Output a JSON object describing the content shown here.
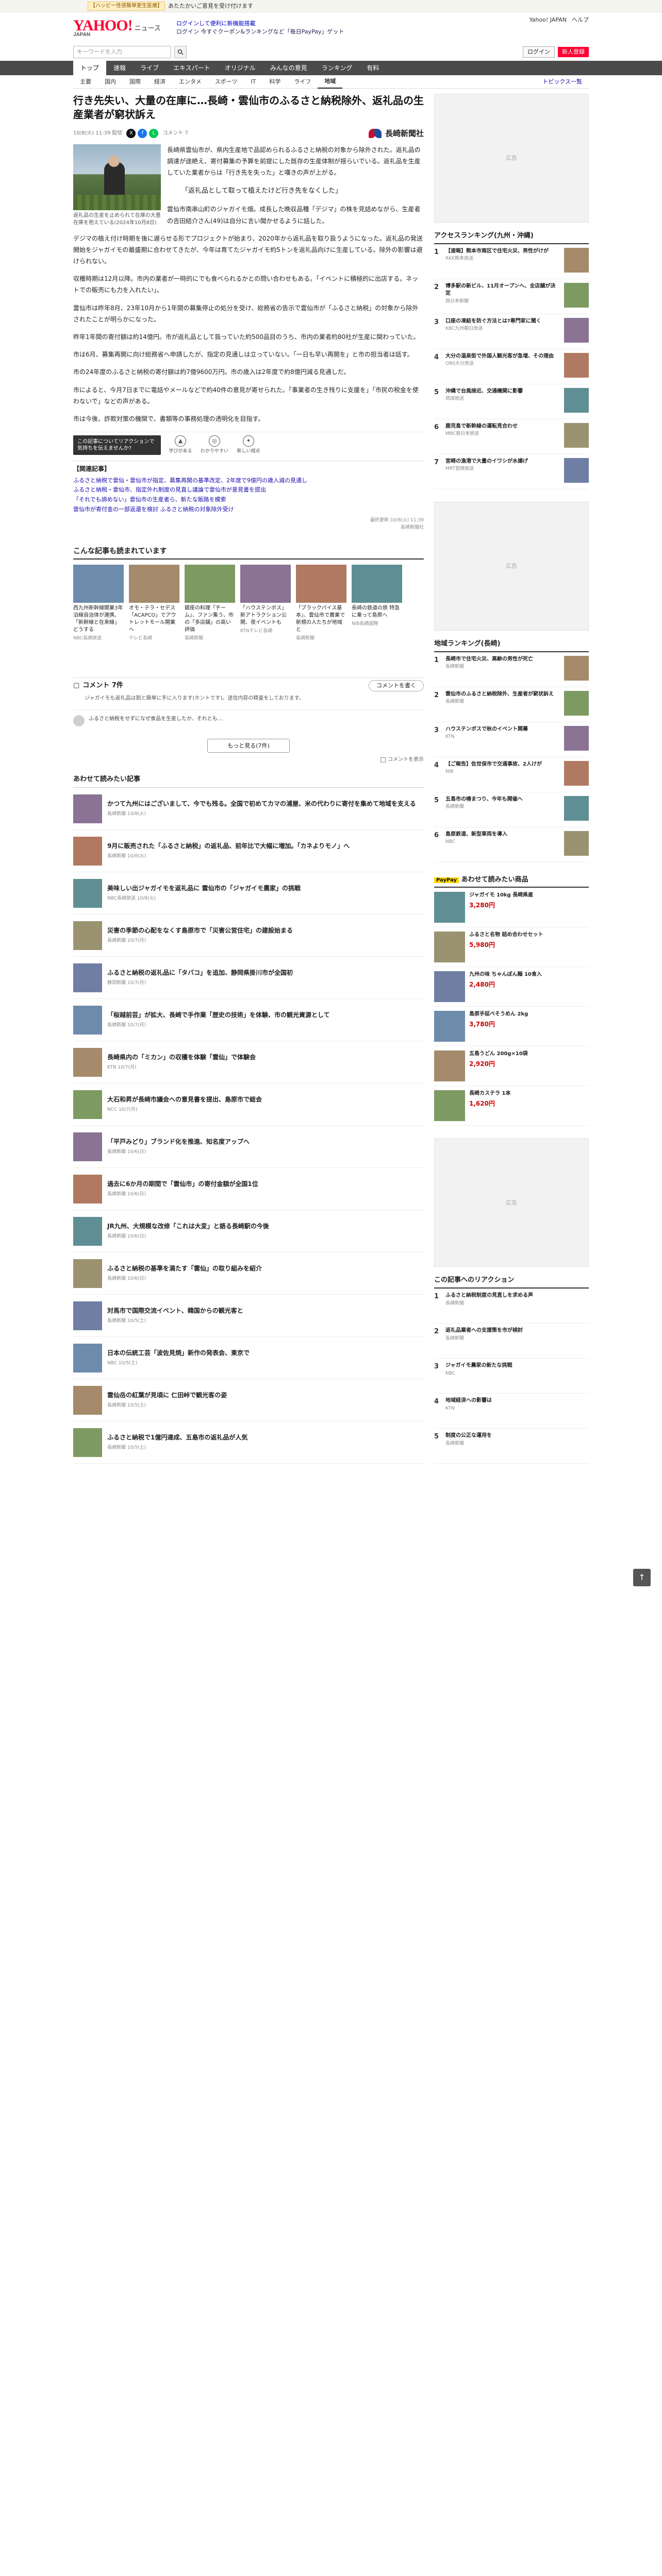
{
  "topbar": {
    "tag": "【ハッピー性感簡単更生医療】",
    "text": "あたたかいご意見を受け付けます"
  },
  "header": {
    "logo": "YAHOO!",
    "logo_sub": "JAPAN",
    "section": "ニュース",
    "link1": "ログインして便利に新機能搭載",
    "link2": "ログイン 今すぐクーポン&ランキングなど「毎日PayPay」ゲット",
    "right": [
      "Yahoo! JAPAN",
      "ヘルプ"
    ]
  },
  "search": {
    "placeholder": "キーワードを入力",
    "login": "ログイン",
    "register": "新人登録"
  },
  "nav": [
    "トップ",
    "速報",
    "ライブ",
    "エキスパート",
    "オリジナル",
    "みんなの意見",
    "ランキング",
    "有料"
  ],
  "subnav": [
    "主要",
    "国内",
    "国際",
    "経済",
    "エンタメ",
    "スポーツ",
    "IT",
    "科学",
    "ライフ",
    "地域"
  ],
  "subnav_active": "地域",
  "topics_link": "トピックス一覧",
  "article": {
    "title": "行き先失い、大量の在庫に…長崎・雲仙市のふるさと納税除外、返礼品の生産業者が窮状訴え",
    "date": "10/8(火) 11:39 配信",
    "comment_count": "コメント 7",
    "publisher": "長崎新聞社",
    "photo_caption": "返礼品の生産を止められて在庫の大量在庫を抱えている(2024年10月8日)",
    "paragraphs": [
      "長崎県雲仙市が、県内生産地で品認められるふるさと納税の対象から除外された。返礼品の調達が途絶え、寄付募集の予算を前提にした既存の生産体制が揺らいでいる。返礼品を生産していた業者からは「行き先を失った」と嘆きの声が上がる。",
      "雲仙市南串山町のジャガイモ畑。成長した晩収品種「デジマ」の株を見詰めながら、生産者の吉田結介さん(49)は自分に言い聞かせるように話した。",
      "デジマの植え付け時期を後に遅らせる形でプロジェクトが始まり、2020年から返礼品を取り扱うようになった。返礼品の発送開始をジャガイモの最盛期に合わせてきたが、今年は育てたジャガイモ約5トンを返礼品向けに生産している。除外の影響は避けられない。",
      "収穫時期は12月以降。市内の業者が一時的にでも食べられるかとの問い合わせもある。「イベントに積極的に出店する。ネットでの販売にも力を入れたい」。",
      "雲仙市は昨年8月、23年10月から1年間の募集停止の処分を受け、総務省の告示で雲仙市が「ふるさと納税」の対象から除外されたことが明らかになった。",
      "昨年1年間の寄付額は約14億円。市が返礼品として扱っていた約500品目のうち、市内の業者約80社が生産に関わっていた。",
      "市は6月、募集再開に向け総務省へ申請したが、指定の見通しは立っていない。「一日も早い再開を」と市の担当者は話す。",
      "市の24年度のふるさと納税の寄付額は約7億9600万円。市の歳入は2年度で約8億円減る見通しだ。",
      "市によると、今月7日までに電話やメールなどで約40件の意見が寄せられた。「事業者の生き残りに支援を」「市民の税金を使わないで」などの声がある。",
      "市は今後、詐欺対策の機関で、書類等の事務処理の透明化を目指す。"
    ],
    "quote": "「返礼品として取って植えたけど行き先をなくした」",
    "tip": "この記事についてリアクションで気持ちを伝えませんか?",
    "reactions": [
      "学びがある",
      "わかりやすい",
      "新しい視点"
    ],
    "related_title": "【関連記事】",
    "related": [
      "ふるさと納税で雲仙・雲仙市が指定、募集再開の基準改定、2年度で9億円の歳入減の見通し",
      "ふるさと納税・雲仙市、指定外れ制度の見直し議論で雲仙市が意見書を提出",
      "「それでも諦めない」雲仙市の生産者ら、新たな販路を模索",
      "雲仙市が寄付金の一部返還を検討 ふるさと納税の対象除外受け"
    ],
    "copyright": "最終更新:10/8(火) 11:39",
    "copyright2": "長崎新聞社"
  },
  "cards": {
    "title": "こんな記事も読まれています",
    "items": [
      {
        "t": "西九州新幹線開業3年 沿線自治体が連携、「新幹線と在来線」どうする",
        "src": "NBC長崎放送"
      },
      {
        "t": "オモ・テラ・セデス「ACAPCO」でアウトレットモール開業へ",
        "src": "テレビ長崎"
      },
      {
        "t": "銀座の料理「チーム」、ファン集う、市の「多店舗」の高い評価",
        "src": "長崎新聞"
      },
      {
        "t": "「ハウステンボス」新アトラクション公開、夜イベントも",
        "src": "KTNテレビ長崎"
      },
      {
        "t": "「ブラックパイス基本」、雲仙市で農業で新規の人たちが地域と",
        "src": "長崎新聞"
      },
      {
        "t": "長崎の鉄道の旅 特急に乗って島原へ",
        "src": "NIB長崎国際"
      }
    ]
  },
  "comments": {
    "title": "コメント 7件",
    "button": "コメントを書く",
    "warn": "ジャガイモも返礼品は割と簡単に手に入ります(ホントです)。送信内容の精査をしております。",
    "first": "ふるさと納税をせずになぜ食品を生産したか、それとも…",
    "more": "もっと見る(7件)",
    "check": "コメントを表示"
  },
  "recommend": {
    "title": "あわせて読みたい記事",
    "items": [
      {
        "t": "かつて九州にはございまして、今でも残る。全国で初めてカマの浦屋、米の代わりに寄付を集めて地域を支える",
        "s": "長崎新聞 10/8(火)"
      },
      {
        "t": "9月に販売された「ふるさと納税」の返礼品、前年比で大幅に増加。「カネよりモノ」へ",
        "s": "長崎新聞 10/8(火)"
      },
      {
        "t": "美味しい出ジャガイモを返礼品に 雲仙市の「ジャガイモ農家」の挑戦",
        "s": "NBC長崎放送 10/8(火)"
      },
      {
        "t": "災害の季節の心配をなくす島原市で「災害公営住宅」の建設始まる",
        "s": "長崎新聞 10/7(月)"
      },
      {
        "t": "ふるさと納税の返礼品に「タバコ」を追加、静岡県掛川市が全国初",
        "s": "静岡新聞 10/7(月)"
      },
      {
        "t": "「桜越前芸」が拡大、長崎で手作業「歴史の技術」を体験、市の観光資源として",
        "s": "長崎新聞 10/7(月)"
      },
      {
        "t": "長崎県内の「ミカン」の収穫を体験「雲仙」で体験会",
        "s": "KTN 10/7(月)"
      },
      {
        "t": "大石和昇が長崎市議会への意見書を提出、島原市で総会",
        "s": "NCC 10/7(月)"
      },
      {
        "t": "「平戸みどり」ブランド化を推進、知名度アップへ",
        "s": "長崎新聞 10/6(日)"
      },
      {
        "t": "過去に6か月の期間で「雲仙市」の寄付金額が全国1位",
        "s": "長崎新聞 10/6(日)"
      },
      {
        "t": "JR九州、大規模な改修「これは大変」と語る長崎駅の今後",
        "s": "長崎新聞 10/6(日)"
      },
      {
        "t": "ふるさと納税の基準を満たす「雲仙」の取り組みを紹介",
        "s": "長崎新聞 10/6(日)"
      },
      {
        "t": "対馬市で国際交流イベント、韓国からの観光客と",
        "s": "長崎新聞 10/5(土)"
      },
      {
        "t": "日本の伝統工芸「波佐見焼」新作の発表会、東京で",
        "s": "NBC 10/5(土)"
      },
      {
        "t": "雲仙岳の紅葉が見頃に 仁田峠で観光客の姿",
        "s": "長崎新聞 10/5(土)"
      },
      {
        "t": "ふるさと納税で1億円達成、五島市の返礼品が人気",
        "s": "長崎新聞 10/5(土)"
      }
    ]
  },
  "side": {
    "ad": "広告",
    "ranking_title": "アクセスランキング(九州・沖縄)",
    "ranking": [
      {
        "t": "【速報】熊本市南区で住宅火災、男性がけが",
        "s": "RKK熊本放送"
      },
      {
        "t": "博多駅の新ビル、11月オープンへ、全店舗が決定",
        "s": "西日本新聞"
      },
      {
        "t": "口座の凍結を防ぐ方法とは?専門家に聞く",
        "s": "KBC九州朝日放送"
      },
      {
        "t": "大分の温泉街で外国人観光客が急増、その理由",
        "s": "OBS大分放送"
      },
      {
        "t": "沖縄で台風接近、交通機関に影響",
        "s": "琉球放送"
      },
      {
        "t": "鹿児島で新幹線の運転見合わせ",
        "s": "MBC南日本放送"
      },
      {
        "t": "宮崎の漁港で大量のイワシが水揚げ",
        "s": "MRT宮崎放送"
      }
    ],
    "local_title": "地域ランキング(長崎)",
    "local": [
      {
        "t": "長崎市で住宅火災、高齢の男性が死亡",
        "s": "長崎新聞"
      },
      {
        "t": "雲仙市のふるさと納税除外、生産者が窮状訴え",
        "s": "長崎新聞"
      },
      {
        "t": "ハウステンボスで秋のイベント開幕",
        "s": "KTN"
      },
      {
        "t": "【ご報告】佐世保市で交通事故、2人けが",
        "s": "NIB"
      },
      {
        "t": "五島市の椿まつり、今年も開催へ",
        "s": "長崎新聞"
      },
      {
        "t": "島原鉄道、新型車両を導入",
        "s": "NBC"
      }
    ],
    "paypay_title": "あわせて読みたい商品",
    "paypay": [
      {
        "t": "ジャガイモ 10kg 長崎県産",
        "p": "3,280円"
      },
      {
        "t": "ふるさと名物 詰め合わせセット",
        "p": "5,980円"
      },
      {
        "t": "九州の味 ちゃんぽん麺 10食入",
        "p": "2,480円"
      },
      {
        "t": "島原手延べそうめん 2kg",
        "p": "3,780円"
      },
      {
        "t": "五島うどん 200g×10袋",
        "p": "2,920円"
      },
      {
        "t": "長崎カステラ 1本",
        "p": "1,620円"
      }
    ],
    "react_title": "この記事へのリアクション",
    "react": [
      {
        "t": "ふるさと納税制度の見直しを求める声",
        "s": "長崎新聞"
      },
      {
        "t": "返礼品業者への支援策を市が検討",
        "s": "長崎新聞"
      },
      {
        "t": "ジャガイモ農家の新たな挑戦",
        "s": "NBC"
      },
      {
        "t": "地域経済への影響は",
        "s": "KTN"
      },
      {
        "t": "制度の公正な運用を",
        "s": "長崎新聞"
      }
    ]
  },
  "pagetop": "↑"
}
